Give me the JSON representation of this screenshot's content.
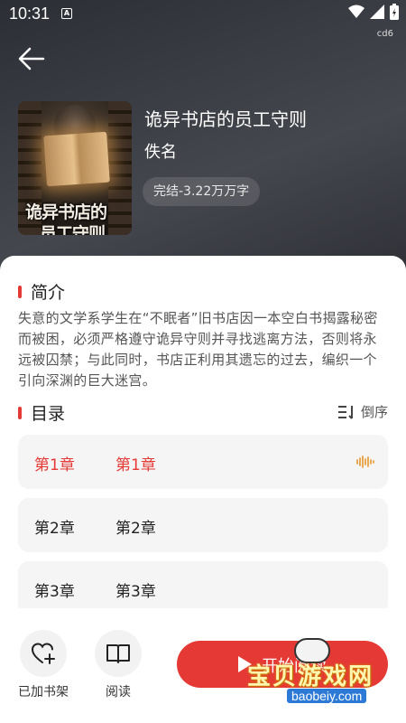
{
  "status_bar": {
    "time": "10:31",
    "notification": "A",
    "build_tag": "cd6"
  },
  "book": {
    "title": "诡异书店的员工守则",
    "author": "佚名",
    "meta": "完结-3.22万万字",
    "cover_text": "诡异书店的员工守则"
  },
  "intro": {
    "heading": "简介",
    "text": "失意的文学系学生在“不眠者”旧书店因一本空白书揭露秘密而被困，必须严格遵守诡异守则并寻找逃离方法，否则将永远被囚禁；与此同时，书店正利用其遗忘的过去，编织一个引向深渊的巨大迷宫。"
  },
  "toc": {
    "heading": "目录",
    "order_label": "倒序",
    "chapters": [
      {
        "number": "第1章",
        "name": "第1章",
        "active": true
      },
      {
        "number": "第2章",
        "name": "第2章",
        "active": false
      },
      {
        "number": "第3章",
        "name": "第3章",
        "active": false
      }
    ]
  },
  "bottom": {
    "shelf_label": "已加书架",
    "read_label": "阅读",
    "start_label": "开始阅读"
  },
  "watermark": {
    "text": "宝贝游戏网",
    "url": "baobeiy.com"
  },
  "colors": {
    "accent": "#e53935",
    "header_bg": "#3a3c43"
  }
}
